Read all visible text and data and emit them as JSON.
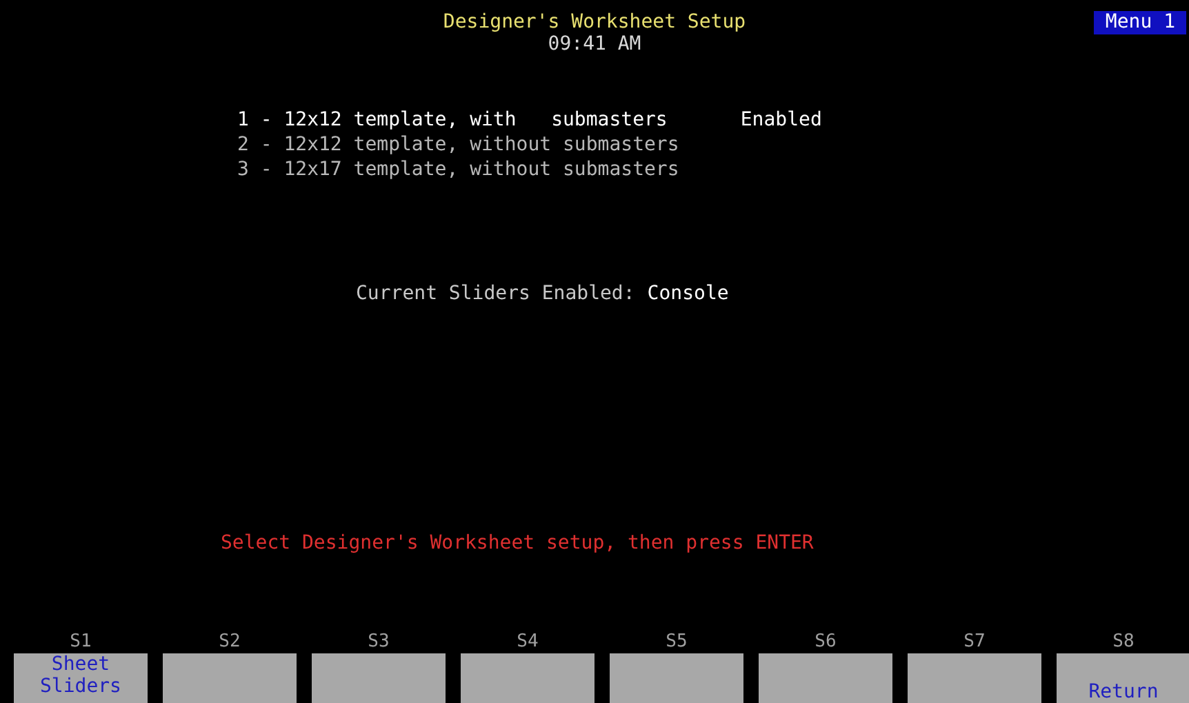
{
  "header": {
    "title": "Designer's Worksheet Setup",
    "time": "09:41 AM",
    "menu": "Menu 1"
  },
  "options": [
    {
      "text": "1 - 12x12 template, with   submasters",
      "selected": true,
      "status": "Enabled"
    },
    {
      "text": "2 - 12x12 template, without submasters",
      "selected": false
    },
    {
      "text": "3 - 12x17 template, without submasters",
      "selected": false
    }
  ],
  "current": {
    "label": "Current Sliders Enabled:",
    "value": "Console"
  },
  "prompt": "Select Designer's Worksheet setup, then press ENTER",
  "softkeys": [
    {
      "key": "S1",
      "label": "Sheet\nSliders",
      "kind": "top"
    },
    {
      "key": "S2"
    },
    {
      "key": "S3"
    },
    {
      "key": "S4"
    },
    {
      "key": "S5"
    },
    {
      "key": "S6"
    },
    {
      "key": "S7"
    },
    {
      "key": "S8",
      "label": "Return",
      "kind": "bottom"
    }
  ]
}
